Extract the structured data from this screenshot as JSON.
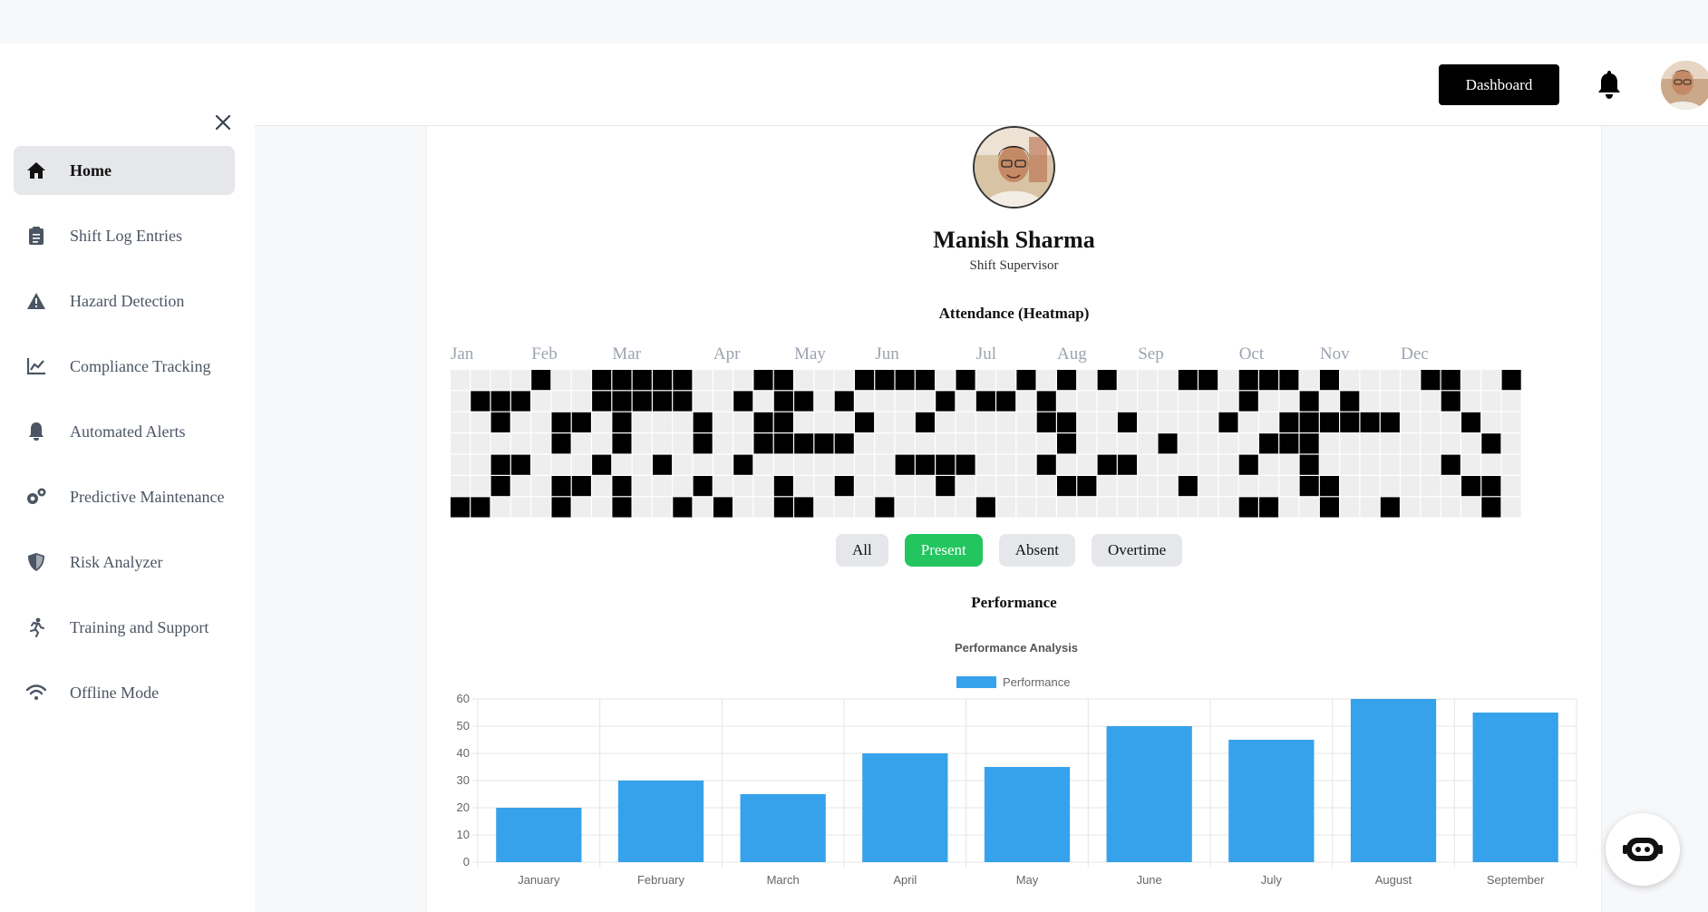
{
  "sidebar": {
    "items": [
      {
        "label": "Home",
        "icon": "home-icon",
        "active": true
      },
      {
        "label": "Shift Log Entries",
        "icon": "clipboard-icon",
        "active": false
      },
      {
        "label": "Hazard Detection",
        "icon": "warning-icon",
        "active": false
      },
      {
        "label": "Compliance Tracking",
        "icon": "chart-line-icon",
        "active": false
      },
      {
        "label": "Automated Alerts",
        "icon": "bell-icon",
        "active": false
      },
      {
        "label": "Predictive Maintenance",
        "icon": "gears-icon",
        "active": false
      },
      {
        "label": "Risk Analyzer",
        "icon": "shield-icon",
        "active": false
      },
      {
        "label": "Training and Support",
        "icon": "running-person-icon",
        "active": false
      },
      {
        "label": "Offline Mode",
        "icon": "wifi-icon",
        "active": false
      }
    ]
  },
  "header": {
    "dashboard_label": "Dashboard"
  },
  "profile": {
    "name": "Manish Sharma",
    "role": "Shift Supervisor"
  },
  "attendance": {
    "title": "Attendance (Heatmap)",
    "months": [
      "Jan",
      "Feb",
      "Mar",
      "Apr",
      "May",
      "Jun",
      "Jul",
      "Aug",
      "Sep",
      "Oct",
      "Nov",
      "Dec"
    ],
    "month_week_index": [
      0,
      4,
      8,
      13,
      17,
      21,
      26,
      30,
      34,
      39,
      43,
      47
    ],
    "filters": [
      "All",
      "Present",
      "Absent",
      "Overtime"
    ],
    "active_filter": "Present",
    "filled_color": "#000000",
    "empty_color": "#eeeeee",
    "weeks": 53,
    "filled_cells": {
      "0": [
        6
      ],
      "1": [
        1,
        6
      ],
      "2": [
        1,
        2,
        4,
        5
      ],
      "3": [
        1,
        4
      ],
      "4": [
        0
      ],
      "5": [
        2,
        3,
        5,
        6
      ],
      "6": [
        2,
        5
      ],
      "7": [
        0,
        1,
        4
      ],
      "8": [
        0,
        1,
        2,
        3,
        5,
        6
      ],
      "9": [
        0,
        1
      ],
      "10": [
        0,
        1,
        4
      ],
      "11": [
        0,
        1,
        6
      ],
      "12": [
        2,
        3,
        5
      ],
      "13": [
        6
      ],
      "14": [
        1,
        4
      ],
      "15": [
        0,
        2,
        3
      ],
      "16": [
        0,
        1,
        2,
        3,
        5,
        6
      ],
      "17": [
        1,
        3,
        6
      ],
      "18": [
        3
      ],
      "19": [
        1,
        3,
        5
      ],
      "20": [
        0,
        2
      ],
      "21": [
        0,
        6
      ],
      "22": [
        0,
        4
      ],
      "23": [
        0,
        2,
        4
      ],
      "24": [
        1,
        4,
        5
      ],
      "25": [
        0,
        4
      ],
      "26": [
        1,
        6
      ],
      "27": [
        1
      ],
      "28": [
        0
      ],
      "29": [
        1,
        2,
        4
      ],
      "30": [
        0,
        2,
        3,
        5
      ],
      "31": [
        5
      ],
      "32": [
        0,
        4
      ],
      "33": [
        2,
        4
      ],
      "35": [
        3
      ],
      "36": [
        0,
        5
      ],
      "37": [
        0
      ],
      "38": [
        2
      ],
      "39": [
        0,
        1,
        4,
        6
      ],
      "40": [
        0,
        3,
        6
      ],
      "41": [
        0,
        2,
        3
      ],
      "42": [
        1,
        2,
        3,
        4,
        5
      ],
      "43": [
        0,
        2,
        5,
        6
      ],
      "44": [
        1,
        2
      ],
      "45": [
        2
      ],
      "46": [
        2,
        6
      ],
      "48": [
        0
      ],
      "49": [
        0,
        1,
        4
      ],
      "50": [
        2,
        5
      ],
      "51": [
        3,
        5,
        6
      ],
      "52": [
        0
      ]
    }
  },
  "performance": {
    "title": "Performance"
  },
  "chart_data": {
    "type": "bar",
    "title": "Performance Analysis",
    "categories": [
      "January",
      "February",
      "March",
      "April",
      "May",
      "June",
      "July",
      "August",
      "September"
    ],
    "series": [
      {
        "name": "Performance",
        "values": [
          20,
          30,
          25,
          40,
          35,
          50,
          45,
          60,
          55
        ],
        "color": "#36a2eb"
      }
    ],
    "ylim": [
      0,
      60
    ],
    "yticks": [
      0,
      10,
      20,
      30,
      40,
      50,
      60
    ],
    "legend": "top",
    "grid": true
  }
}
